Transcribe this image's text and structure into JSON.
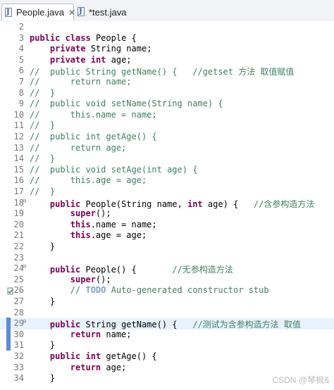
{
  "tabs": [
    {
      "label": "People.java",
      "active": true,
      "closable": true
    },
    {
      "label": "*test.java",
      "active": false,
      "closable": false
    }
  ],
  "editor": {
    "lines": [
      {
        "n": "2",
        "text": ""
      },
      {
        "n": "3",
        "text": "public class People {"
      },
      {
        "n": "4",
        "text": "    private String name;"
      },
      {
        "n": "5",
        "text": "    private int age;"
      },
      {
        "n": "6",
        "text": "//  public String getName() {   //getset 方法 取值赋值"
      },
      {
        "n": "7",
        "text": "//      return name;"
      },
      {
        "n": "8",
        "text": "//  }"
      },
      {
        "n": "9",
        "text": "//  public void setName(String name) {"
      },
      {
        "n": "10",
        "text": "//      this.name = name;"
      },
      {
        "n": "11",
        "text": "//  }"
      },
      {
        "n": "12",
        "text": "//  public int getAge() {"
      },
      {
        "n": "13",
        "text": "//      return age;"
      },
      {
        "n": "14",
        "text": "//  }"
      },
      {
        "n": "15",
        "text": "//  public void setAge(int age) {"
      },
      {
        "n": "16",
        "text": "//      this.age = age;"
      },
      {
        "n": "17",
        "text": "//  }"
      },
      {
        "n": "18",
        "text": "    public People(String name, int age) {   //含参构造方法"
      },
      {
        "n": "19",
        "text": "        super();"
      },
      {
        "n": "20",
        "text": "        this.name = name;"
      },
      {
        "n": "21",
        "text": "        this.age = age;"
      },
      {
        "n": "22",
        "text": "    }"
      },
      {
        "n": "23",
        "text": ""
      },
      {
        "n": "24",
        "text": "    public People() {       //无参构造方法"
      },
      {
        "n": "25",
        "text": "        super();"
      },
      {
        "n": "26",
        "text": "        // TODO Auto-generated constructor stub"
      },
      {
        "n": "27",
        "text": "    }"
      },
      {
        "n": "28",
        "text": ""
      },
      {
        "n": "29",
        "text": "    public String getName() {   //测试为含参构造方法 取值"
      },
      {
        "n": "30",
        "text": "        return name;"
      },
      {
        "n": "31",
        "text": "    }"
      },
      {
        "n": "32",
        "text": "    public int getAge() {"
      },
      {
        "n": "33",
        "text": "        return age;"
      },
      {
        "n": "34",
        "text": "    }"
      }
    ]
  },
  "watermark": "CSDN @琴枫&",
  "colors": {
    "keyword": "#7f0055",
    "comment": "#3f7f5f",
    "field": "#0000c0",
    "highlight": "#e8f2fe",
    "marker": "#5b8dd6"
  }
}
